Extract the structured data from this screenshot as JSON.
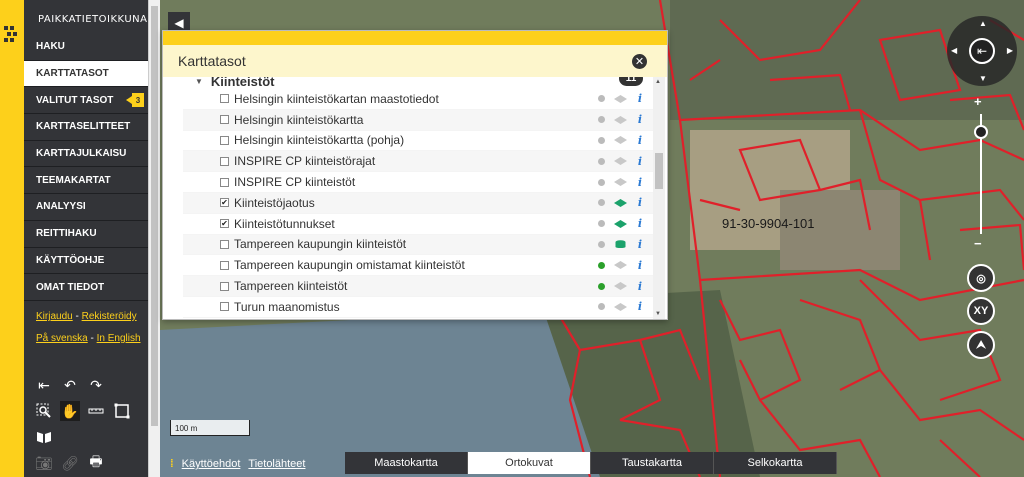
{
  "app": {
    "title": "PAIKKATIETOIKKUNA"
  },
  "nav": [
    {
      "label": "HAKU"
    },
    {
      "label": "KARTTATASOT",
      "active": true
    },
    {
      "label": "VALITUT TASOT",
      "badge": "3"
    },
    {
      "label": "KARTTASELITTEET"
    },
    {
      "label": "KARTTAJULKAISU"
    },
    {
      "label": "TEEMAKARTAT"
    },
    {
      "label": "ANALYYSI"
    },
    {
      "label": "REITTIHAKU"
    },
    {
      "label": "KÄYTTÖOHJE"
    },
    {
      "label": "OMAT TIEDOT"
    }
  ],
  "auth": {
    "login": "Kirjaudu",
    "sep": " - ",
    "register": "Rekisteröidy"
  },
  "lang": {
    "swedish": "På svenska",
    "sep": " - ",
    "english": "In English"
  },
  "panel": {
    "title": "Karttatasot",
    "group": {
      "name": "Kiinteistöt",
      "count": "11"
    },
    "layers": [
      {
        "name": "Helsingin kiinteistökartan maastotiedot",
        "checked": false,
        "status": "grey",
        "icon": "layer-grey"
      },
      {
        "name": "Helsingin kiinteistökartta",
        "checked": false,
        "status": "grey",
        "icon": "layer-grey"
      },
      {
        "name": "Helsingin kiinteistökartta (pohja)",
        "checked": false,
        "status": "grey",
        "icon": "layer-grey"
      },
      {
        "name": "INSPIRE CP kiinteistörajat",
        "checked": false,
        "status": "grey",
        "icon": "layer-grey"
      },
      {
        "name": "INSPIRE CP kiinteistöt",
        "checked": false,
        "status": "grey",
        "icon": "layer-grey"
      },
      {
        "name": "Kiinteistöjaotus",
        "checked": true,
        "status": "grey",
        "icon": "layer-green"
      },
      {
        "name": "Kiinteistötunnukset",
        "checked": true,
        "status": "grey",
        "icon": "layer-green"
      },
      {
        "name": "Tampereen kaupungin kiinteistöt",
        "checked": false,
        "status": "grey",
        "icon": "database-green"
      },
      {
        "name": "Tampereen kaupungin omistamat kiinteistöt",
        "checked": false,
        "status": "green",
        "icon": "layer-grey"
      },
      {
        "name": "Tampereen kiinteistöt",
        "checked": false,
        "status": "green",
        "icon": "layer-grey"
      },
      {
        "name": "Turun maanomistus",
        "checked": false,
        "status": "grey",
        "icon": "layer-grey"
      }
    ]
  },
  "map": {
    "parcel_labels": [
      "91-30-9904-101"
    ],
    "scale": "100 m"
  },
  "footer": {
    "terms": "Käyttöehdot",
    "sources": "Tietolähteet"
  },
  "basemaps": [
    {
      "label": "Maastokartta",
      "selected": false
    },
    {
      "label": "Ortokuvat",
      "selected": true
    },
    {
      "label": "Taustakartta",
      "selected": false
    },
    {
      "label": "Selkokartta",
      "selected": false
    }
  ],
  "controls": {
    "xy": "XY",
    "zoom_in": "+",
    "zoom_out": "−"
  },
  "colors": {
    "accent": "#fdd01b",
    "sidebar": "#333438",
    "parcel": "#e0202a",
    "active_layer": "#1ba26b"
  }
}
